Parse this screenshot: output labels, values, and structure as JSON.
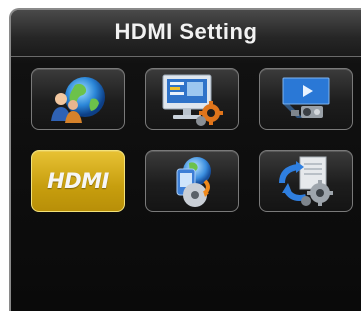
{
  "menu": {
    "title": "HDMI Setting",
    "items": [
      {
        "id": "network",
        "icon": "network-globe-users-icon",
        "selected": false
      },
      {
        "id": "display",
        "icon": "monitor-settings-icon",
        "selected": false
      },
      {
        "id": "video-output",
        "icon": "projector-screen-icon",
        "selected": false
      },
      {
        "id": "hdmi",
        "icon": "hdmi-logo-icon",
        "label": "HDMI",
        "selected": true
      },
      {
        "id": "media-update",
        "icon": "disc-update-icon",
        "selected": false
      },
      {
        "id": "system-tools",
        "icon": "sync-gears-icon",
        "selected": false
      }
    ]
  },
  "colors": {
    "selected_tile": "#d4aa1a",
    "tile_bg": "#222222",
    "title_text": "#f2f2f2"
  }
}
